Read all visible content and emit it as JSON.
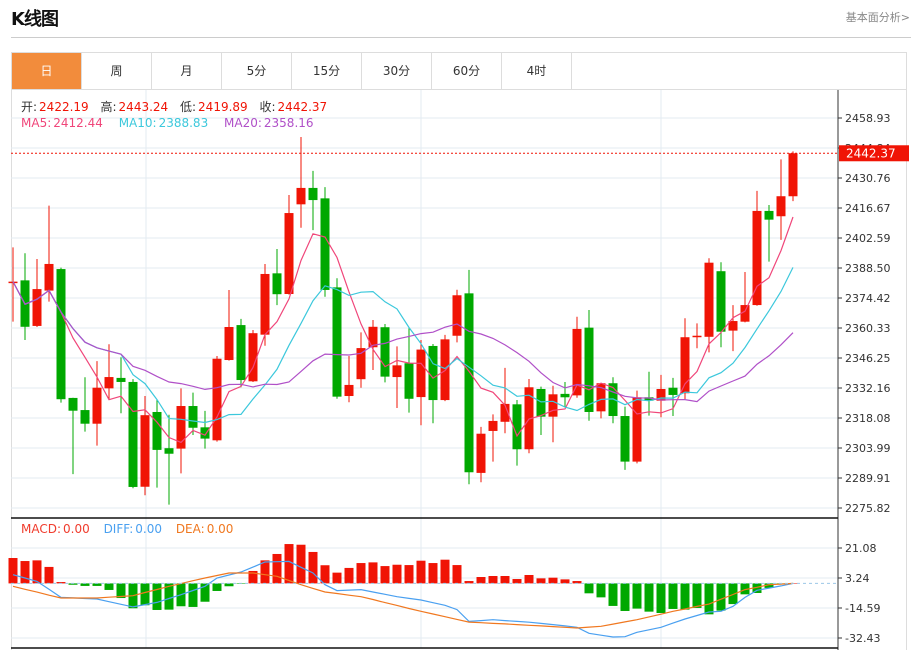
{
  "header": {
    "title": "K线图",
    "fundamental_link": "基本面分析>"
  },
  "tabs": [
    {
      "label": "日",
      "active": true
    },
    {
      "label": "周"
    },
    {
      "label": "月"
    },
    {
      "label": "5分"
    },
    {
      "label": "15分"
    },
    {
      "label": "30分"
    },
    {
      "label": "60分"
    },
    {
      "label": "4时"
    }
  ],
  "ohlc_legend": {
    "open_label": "开:",
    "open": "2422.19",
    "high_label": "高:",
    "high": "2443.24",
    "low_label": "低:",
    "low": "2419.89",
    "close_label": "收:",
    "close": "2442.37"
  },
  "ma_legend": {
    "ma5_label": "MA5:",
    "ma5": "2412.44",
    "ma10_label": "MA10:",
    "ma10": "2388.83",
    "ma20_label": "MA20:",
    "ma20": "2358.16"
  },
  "macd_legend": {
    "macd_label": "MACD:",
    "macd": "0.00",
    "diff_label": "DIFF:",
    "diff": "0.00",
    "dea_label": "DEA:",
    "dea": "0.00"
  },
  "last_price": "2442.37",
  "colors": {
    "up": "#f01405",
    "down": "#00a800",
    "ma5": "#f0467a",
    "ma10": "#3cc8dc",
    "ma20": "#b050c8",
    "macd": "#f03c2d",
    "diff": "#4aa0f0",
    "dea": "#f07820",
    "active_tab": "#f28c3c"
  },
  "chart_data": {
    "type": "candlestick",
    "price_axis": {
      "range": [
        2275.82,
        2458.93
      ],
      "ticks": [
        "2458.93",
        "2444.84",
        "2430.76",
        "2416.67",
        "2402.59",
        "2388.50",
        "2374.42",
        "2360.33",
        "2346.25",
        "2332.16",
        "2318.08",
        "2303.99",
        "2289.91",
        "2275.82"
      ]
    },
    "macd_axis": {
      "range": [
        -35.0,
        32.0
      ],
      "ticks": [
        "21.08",
        "3.24",
        "-14.59",
        "-32.43"
      ]
    },
    "candles": [
      [
        2381.8,
        2398.2,
        2363.3,
        2382.1
      ],
      [
        2382.7,
        2395.4,
        2354.7,
        2360.9
      ],
      [
        2361.3,
        2392.7,
        2360.8,
        2378.6
      ],
      [
        2377.9,
        2417.8,
        2372.7,
        2390.4
      ],
      [
        2388.0,
        2388.7,
        2325.3,
        2326.9
      ],
      [
        2327.5,
        2327.6,
        2291.7,
        2321.5
      ],
      [
        2321.8,
        2337.2,
        2311.7,
        2315.4
      ],
      [
        2315.4,
        2344.8,
        2305.1,
        2332.3
      ],
      [
        2332.0,
        2352.7,
        2326.5,
        2337.3
      ],
      [
        2336.9,
        2346.6,
        2320.3,
        2335.0
      ],
      [
        2335.0,
        2336.3,
        2285.1,
        2285.7
      ],
      [
        2285.8,
        2328.4,
        2281.8,
        2319.4
      ],
      [
        2320.9,
        2326.5,
        2285.4,
        2303.1
      ],
      [
        2303.9,
        2319.6,
        2277.4,
        2301.3
      ],
      [
        2303.7,
        2332.0,
        2292.1,
        2323.7
      ],
      [
        2323.7,
        2330.0,
        2310.1,
        2313.5
      ],
      [
        2313.7,
        2321.4,
        2303.7,
        2308.4
      ],
      [
        2307.6,
        2347.2,
        2307.0,
        2345.9
      ],
      [
        2345.3,
        2378.2,
        2345.0,
        2360.8
      ],
      [
        2361.7,
        2364.6,
        2332.5,
        2335.9
      ],
      [
        2335.3,
        2359.4,
        2335.0,
        2357.9
      ],
      [
        2357.2,
        2390.4,
        2352.0,
        2385.7
      ],
      [
        2386.0,
        2397.4,
        2371.1,
        2376.2
      ],
      [
        2376.3,
        2422.8,
        2376.0,
        2414.3
      ],
      [
        2418.4,
        2450.0,
        2407.4,
        2426.1
      ],
      [
        2426.1,
        2434.1,
        2406.3,
        2420.4
      ],
      [
        2421.2,
        2426.5,
        2375.0,
        2378.2
      ],
      [
        2379.4,
        2383.7,
        2327.1,
        2328.1
      ],
      [
        2328.4,
        2347.2,
        2325.5,
        2333.6
      ],
      [
        2336.3,
        2358.3,
        2332.3,
        2350.9
      ],
      [
        2351.3,
        2364.1,
        2340.6,
        2360.9
      ],
      [
        2360.7,
        2362.2,
        2334.8,
        2337.5
      ],
      [
        2337.3,
        2351.7,
        2322.8,
        2342.8
      ],
      [
        2343.8,
        2360.2,
        2320.6,
        2327.1
      ],
      [
        2327.9,
        2354.7,
        2314.7,
        2350.2
      ],
      [
        2351.9,
        2352.8,
        2315.6,
        2326.5
      ],
      [
        2326.5,
        2357.1,
        2326.0,
        2355.0
      ],
      [
        2356.7,
        2378.3,
        2353.6,
        2375.7
      ],
      [
        2376.6,
        2387.6,
        2287.0,
        2292.6
      ],
      [
        2292.3,
        2313.9,
        2287.9,
        2310.7
      ],
      [
        2312.0,
        2319.8,
        2297.6,
        2316.7
      ],
      [
        2316.3,
        2341.6,
        2310.9,
        2324.7
      ],
      [
        2324.5,
        2326.5,
        2295.7,
        2303.4
      ],
      [
        2303.4,
        2336.4,
        2301.5,
        2332.5
      ],
      [
        2331.7,
        2332.8,
        2310.1,
        2318.7
      ],
      [
        2318.7,
        2333.2,
        2306.7,
        2329.2
      ],
      [
        2329.4,
        2335.0,
        2323.4,
        2327.8
      ],
      [
        2328.7,
        2365.6,
        2327.6,
        2359.9
      ],
      [
        2360.5,
        2368.8,
        2316.8,
        2320.9
      ],
      [
        2321.2,
        2334.4,
        2317.9,
        2334.4
      ],
      [
        2334.4,
        2337.2,
        2315.6,
        2319.0
      ],
      [
        2319.0,
        2323.4,
        2293.7,
        2297.6
      ],
      [
        2297.6,
        2330.9,
        2296.8,
        2327.8
      ],
      [
        2327.8,
        2339.8,
        2319.2,
        2326.2
      ],
      [
        2326.2,
        2338.3,
        2318.4,
        2331.7
      ],
      [
        2332.3,
        2336.9,
        2319.0,
        2328.9
      ],
      [
        2329.7,
        2364.9,
        2326.9,
        2356.0
      ],
      [
        2356.6,
        2362.5,
        2350.8,
        2356.7
      ],
      [
        2356.2,
        2393.1,
        2348.9,
        2391.0
      ],
      [
        2387.0,
        2391.2,
        2351.3,
        2358.6
      ],
      [
        2359.1,
        2371.1,
        2349.5,
        2363.6
      ],
      [
        2363.3,
        2386.6,
        2363.0,
        2371.1
      ],
      [
        2371.1,
        2424.7,
        2370.8,
        2415.3
      ],
      [
        2415.3,
        2418.1,
        2391.5,
        2411.2
      ],
      [
        2412.8,
        2439.5,
        2401.7,
        2422.2
      ],
      [
        2422.19,
        2443.24,
        2419.89,
        2442.37
      ]
    ],
    "macd_hist": [
      15.1,
      13.3,
      13.7,
      9.8,
      0.8,
      -0.8,
      -1.5,
      -1.5,
      -3.9,
      -8.7,
      -14.8,
      -13.0,
      -15.8,
      -15.6,
      -13.6,
      -14.0,
      -10.9,
      -4.5,
      -1.7,
      -0.2,
      7.4,
      13.7,
      17.5,
      23.4,
      23.0,
      18.7,
      10.8,
      6.4,
      9.2,
      12.1,
      12.5,
      10.3,
      11.1,
      10.9,
      13.5,
      12.1,
      14.1,
      10.9,
      1.4,
      3.8,
      4.4,
      4.4,
      2.6,
      5.0,
      3.0,
      3.4,
      2.4,
      1.4,
      -5.9,
      -8.3,
      -13.4,
      -16.4,
      -15.0,
      -16.8,
      -17.6,
      -15.2,
      -15.6,
      -14.6,
      -18.4,
      -16.2,
      -12.3,
      -6.5,
      -5.7,
      -2.7,
      -0.5,
      0.0
    ],
    "diff": [
      5.2,
      3.2,
      1.2,
      -3.5,
      -8.3,
      -8.6,
      -9.0,
      -9.3,
      -10.9,
      -12.4,
      -14.0,
      -12.6,
      -11.3,
      -9.0,
      -6.7,
      -4.2,
      -1.7,
      3.2,
      5.0,
      6.8,
      9.7,
      12.7,
      12.9,
      13.1,
      9.6,
      6.2,
      -0.8,
      -4.3,
      -4.0,
      -3.7,
      -5.1,
      -6.5,
      -7.9,
      -8.9,
      -9.9,
      -11.5,
      -13.0,
      -15.6,
      -22.6,
      -22.1,
      -21.6,
      -22.1,
      -22.6,
      -23.1,
      -23.8,
      -24.5,
      -25.3,
      -26.1,
      -29.7,
      -30.8,
      -31.9,
      -31.7,
      -29.1,
      -27.6,
      -26.1,
      -23.6,
      -21.2,
      -19.1,
      -17.0,
      -16.6,
      -13.6,
      -8.3,
      -4.1,
      -2.8,
      -1.5,
      0.0
    ],
    "dea": [
      -1.7,
      -3.5,
      -5.2,
      -7.0,
      -8.7,
      -8.7,
      -8.7,
      -8.7,
      -8.2,
      -7.8,
      -7.3,
      -5.4,
      -3.6,
      -1.7,
      -0.1,
      1.6,
      3.2,
      4.7,
      6.2,
      6.2,
      6.2,
      5.2,
      4.2,
      1.7,
      -0.8,
      -3.0,
      -5.1,
      -6.0,
      -7.0,
      -7.9,
      -9.6,
      -11.4,
      -13.1,
      -14.9,
      -16.6,
      -18.2,
      -19.8,
      -21.4,
      -23.0,
      -23.4,
      -23.8,
      -24.1,
      -24.5,
      -24.9,
      -25.3,
      -25.7,
      -26.1,
      -26.5,
      -26.0,
      -25.5,
      -24.2,
      -22.9,
      -21.6,
      -19.9,
      -18.3,
      -16.6,
      -15.2,
      -13.7,
      -12.3,
      -9.4,
      -6.6,
      -3.7,
      -2.3,
      -0.8,
      -0.4,
      0.0
    ],
    "ma_periods": [
      5,
      10,
      20
    ]
  }
}
